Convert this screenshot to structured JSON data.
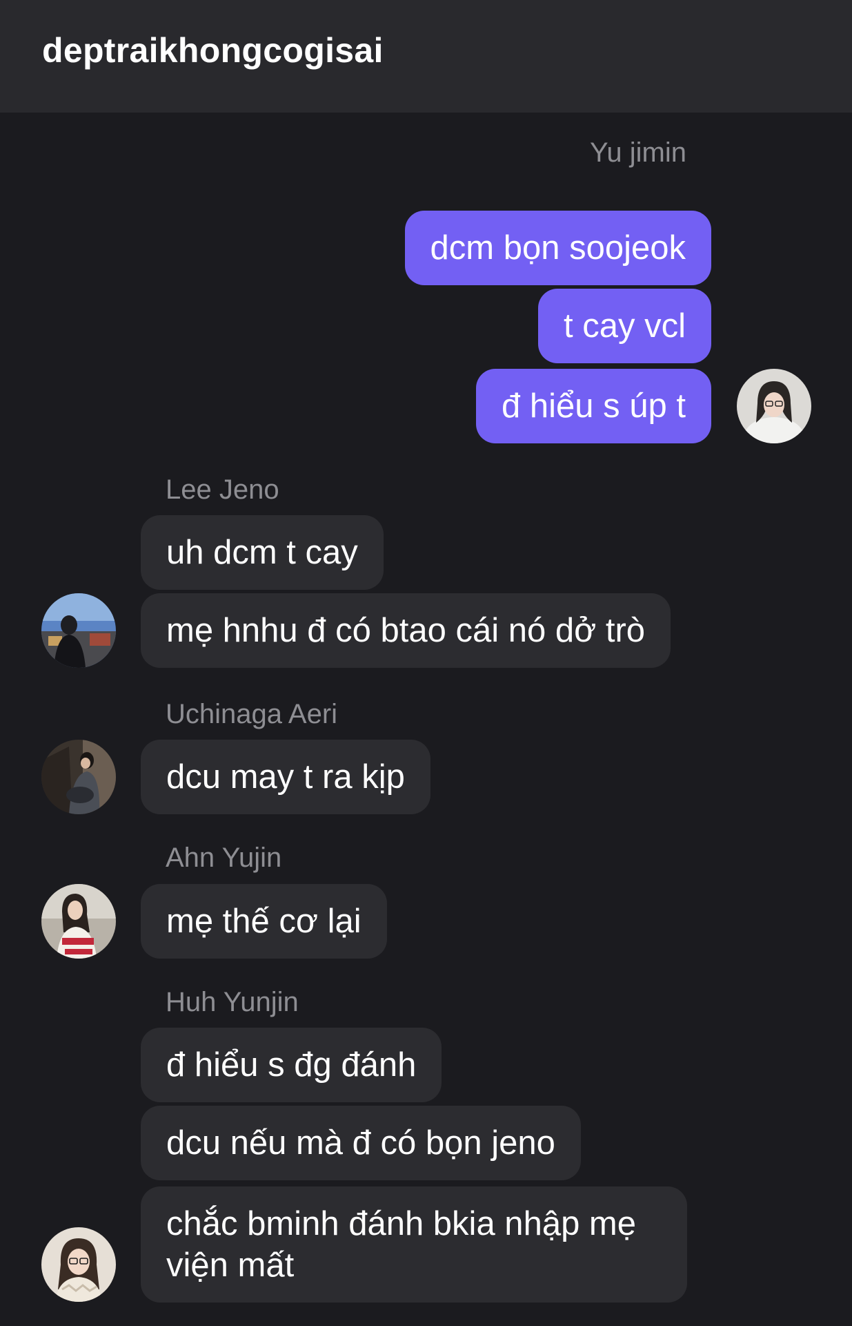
{
  "header": {
    "title": "deptraikhongcogisai"
  },
  "messages": {
    "group1": {
      "sender": "Yu jimin",
      "bubbles": [
        "dcm bọn soojeok",
        "t cay vcl",
        "đ hiểu s úp t"
      ]
    },
    "group2": {
      "sender": "Lee Jeno",
      "bubbles": [
        "uh dcm t cay",
        "mẹ hnhu đ có btao cái nó dở trò"
      ]
    },
    "group3": {
      "sender": "Uchinaga Aeri",
      "bubbles": [
        "dcu may t ra kịp"
      ]
    },
    "group4": {
      "sender": "Ahn Yujin",
      "bubbles": [
        "mẹ thế cơ lại"
      ]
    },
    "group5": {
      "sender": "Huh Yunjin",
      "bubbles": [
        "đ hiểu s đg đánh",
        "dcu nếu mà đ có bọn jeno",
        "chắc bminh đánh bkia nhập mẹ viện mất"
      ]
    }
  },
  "colors": {
    "background": "#1b1b1f",
    "header": "#29292d",
    "outgoing_bubble": "#7360f3",
    "incoming_bubble": "#2c2c30",
    "sender_name": "#8e8e93"
  }
}
